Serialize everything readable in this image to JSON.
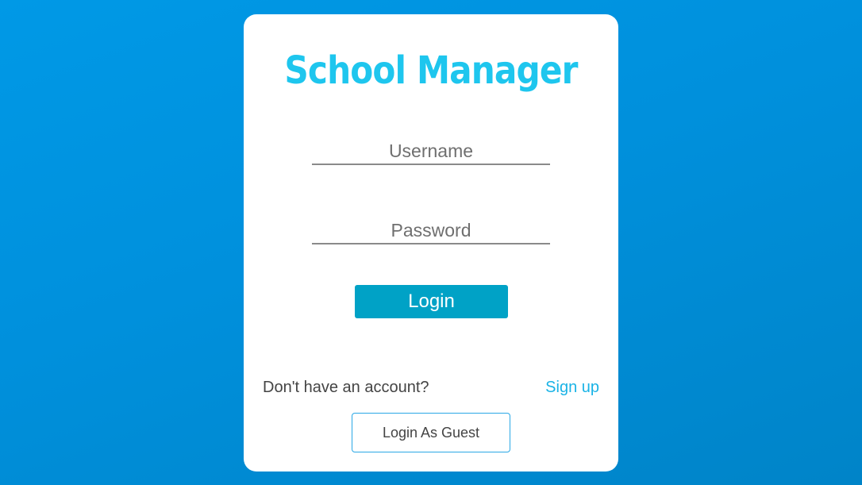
{
  "app": {
    "title": "School Manager",
    "accent_color": "#1ec6ee",
    "background_color": "#0093e0"
  },
  "form": {
    "username": {
      "value": "",
      "placeholder": "Username"
    },
    "password": {
      "value": "",
      "placeholder": "Password"
    },
    "login_label": "Login"
  },
  "footer": {
    "no_account_text": "Don't have an account?",
    "signup_label": "Sign up",
    "guest_label": "Login As Guest"
  }
}
